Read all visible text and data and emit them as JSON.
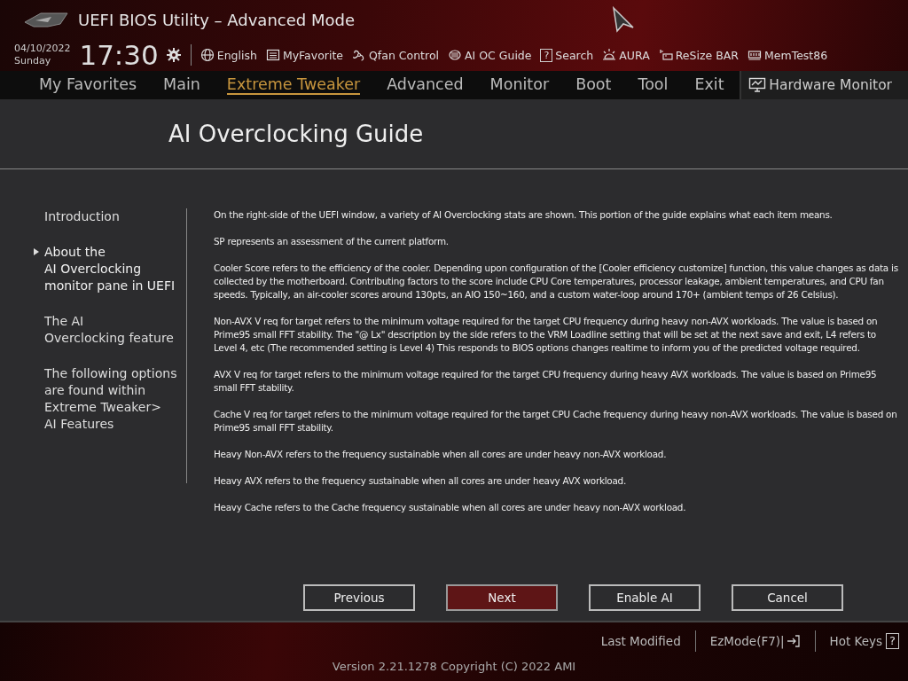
{
  "header": {
    "title": "UEFI BIOS Utility – Advanced Mode",
    "date": "04/10/2022",
    "day": "Sunday",
    "time": "17:30",
    "toolbar": [
      {
        "label": "English"
      },
      {
        "label": "MyFavorite"
      },
      {
        "label": "Qfan Control"
      },
      {
        "label": "AI OC Guide"
      },
      {
        "label": "Search",
        "glyph": "?"
      },
      {
        "label": "AURA"
      },
      {
        "label": "ReSize BAR"
      },
      {
        "label": "MemTest86"
      }
    ]
  },
  "tabs": [
    {
      "label": "My Favorites",
      "selected": false
    },
    {
      "label": "Main",
      "selected": false
    },
    {
      "label": "Extreme Tweaker",
      "selected": true
    },
    {
      "label": "Advanced",
      "selected": false
    },
    {
      "label": "Monitor",
      "selected": false
    },
    {
      "label": "Boot",
      "selected": false
    },
    {
      "label": "Tool",
      "selected": false
    },
    {
      "label": "Exit",
      "selected": false
    }
  ],
  "hardware_monitor": "Hardware Monitor",
  "guide": {
    "title": "AI Overclocking Guide",
    "sections": [
      {
        "lines": [
          "Introduction"
        ],
        "selected": false
      },
      {
        "lines": [
          "About the",
          "AI Overclocking",
          "monitor pane in UEFI"
        ],
        "selected": true
      },
      {
        "lines": [
          "The AI",
          "Overclocking feature"
        ],
        "selected": false
      },
      {
        "lines": [
          "The following options",
          "are found within",
          "Extreme Tweaker>",
          "AI Features"
        ],
        "selected": false
      }
    ],
    "paragraphs": [
      "On the right-side of the UEFI window, a variety of AI Overclocking stats are shown. This portion of the guide explains what each item means.",
      "SP represents an assessment of the current platform.",
      "Cooler Score refers to the efficiency of the cooler. Depending upon configuration of the [Cooler efficiency customize] function, this value changes as data is collected by the motherboard. Contributing factors to the score include CPU Core temperatures, processor leakage, ambient temperatures, and CPU fan speeds. Typically, an air-cooler scores around 130pts, an AIO 150~160, and a custom water-loop around 170+ (ambient temps of 26 Celsius).",
      "Non-AVX V req for target refers to the minimum voltage required for the target CPU frequency during heavy non-AVX workloads. The value is based on Prime95 small FFT stability. The \"@ Lx\" description by the side refers to the VRM Loadline setting that will be set at the next save and exit, L4 refers to Level 4, etc (The recommended setting is Level 4) This responds to BIOS options changes realtime to inform you of the predicted voltage required.",
      "AVX V req for target refers to the minimum voltage required for the target CPU frequency during heavy AVX workloads. The value is based on Prime95 small FFT stability.",
      "Cache V req for target refers to the minimum voltage required for the target CPU Cache frequency during heavy non-AVX workloads. The value is based on Prime95 small FFT stability.",
      "Heavy Non-AVX refers to the frequency sustainable when all cores are under heavy non-AVX workload.",
      "Heavy AVX refers to the frequency sustainable when all cores are under heavy AVX workload.",
      "Heavy Cache refers to the Cache frequency sustainable when all cores are under heavy non-AVX workload."
    ],
    "buttons": [
      {
        "label": "Previous",
        "selected": false
      },
      {
        "label": "Next",
        "selected": true
      },
      {
        "label": "Enable AI",
        "selected": false
      },
      {
        "label": "Cancel",
        "selected": false
      }
    ]
  },
  "footer": {
    "last_modified": "Last Modified",
    "ezmode": "EzMode(F7)|",
    "hot_keys": "Hot Keys",
    "hot_keys_glyph": "?",
    "version": "Version 2.21.1278 Copyright (C) 2022 AMI"
  }
}
